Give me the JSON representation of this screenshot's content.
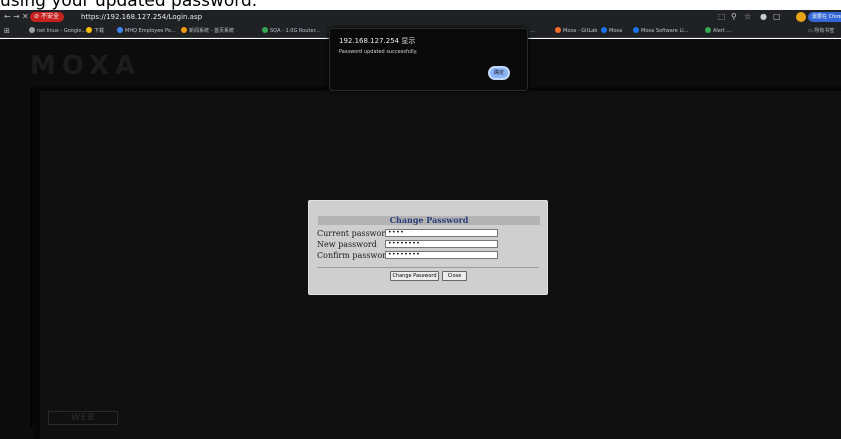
{
  "caption": {
    "text": "using your updated password."
  },
  "browser": {
    "back_icon": "arrow-left-icon",
    "forward_icon": "arrow-right-icon",
    "close_icon": "close-icon",
    "security_label": "不安全",
    "url": "https://192.168.127.254/Login.asp",
    "update_label": "需要在 Chrome 中安装"
  },
  "bookmarks": {
    "items": [
      {
        "label": "net linux - Google...",
        "color": "#9aa0a6"
      },
      {
        "label": "下载",
        "color": "#fbbc04"
      },
      {
        "label": "MHQ Employee Po...",
        "color": "#4285f4"
      },
      {
        "label": "新闻系统 - 首页系统",
        "color": "#f29900"
      },
      {
        "label": "SQA - 1.0G Router...",
        "color": "#34a853"
      },
      {
        "label": "...",
        "color": "#888"
      },
      {
        "label": "Moxa - GitLab",
        "color": "#fc6d26"
      },
      {
        "label": "Moxa",
        "color": "#1a73e8"
      },
      {
        "label": "Moxa Software Li...",
        "color": "#1a73e8"
      },
      {
        "label": "Alert ...",
        "color": "#34a853"
      }
    ],
    "all_bookmarks_label": "所有书签"
  },
  "page": {
    "logo": "MOXA",
    "web_badge": "WEB"
  },
  "change_password": {
    "title": "Change Password",
    "current_label": "Current password",
    "current_value": "••••",
    "new_label": "New password",
    "new_value": "••••••••",
    "confirm_label": "Confirm password",
    "confirm_value": "••••••••",
    "submit_label": "Change Password",
    "close_label": "Close"
  },
  "alert": {
    "title": "192.168.127.254 显示",
    "message": "Password updated successfully.",
    "ok_label": "确定"
  }
}
